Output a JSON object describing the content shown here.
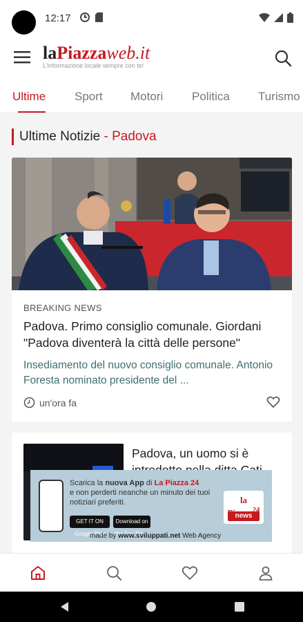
{
  "status": {
    "time": "12:17"
  },
  "header": {
    "logo_prefix": "la",
    "logo_main": "Piazza",
    "logo_suffix": "web.it",
    "logo_tagline": "L'informazione locale sempre con te!"
  },
  "tabs": [
    "Ultime",
    "Sport",
    "Motori",
    "Politica",
    "Turismo"
  ],
  "active_tab": "Ultime",
  "section": {
    "title": "Ultime Notizie",
    "separator": " - ",
    "city": "Padova"
  },
  "featured": {
    "badge": "BREAKING NEWS",
    "title": "Padova. Primo consiglio comunale. Giordani \"Padova diventerà la città delle persone\"",
    "excerpt": "Insediamento del nuovo consiglio comunale. Antonio Foresta nominato presidente del ...",
    "time": "un'ora fa"
  },
  "second": {
    "title": "Padova, un uomo si è introdotto nella ditta Cati"
  },
  "banner": {
    "line1_pre": "Scarica la ",
    "line1_bold": "nuova App",
    "line1_mid": " di ",
    "line1_brand": "La Piazza 24",
    "line2": "e non perderti neanche un minuto dei tuoi notiziari preferiti.",
    "google_play": "GET IT ON Google Play",
    "app_store": "Download on the App Store",
    "logo_text": "la Piazza",
    "logo_num": "24",
    "logo_news": "news",
    "made_by_pre": "made by ",
    "made_by_site": "www.sviluppati.net",
    "made_by_post": " Web Agency"
  },
  "colors": {
    "accent": "#c61a1f",
    "excerpt": "#3f6f6f",
    "banner_bg": "#b7cdd9"
  },
  "icons": {
    "menu": "hamburger-icon",
    "search": "search-icon",
    "clock": "clock-icon",
    "heart": "heart-icon",
    "nav": [
      "home-icon",
      "search-icon",
      "heart-icon",
      "user-icon"
    ]
  }
}
